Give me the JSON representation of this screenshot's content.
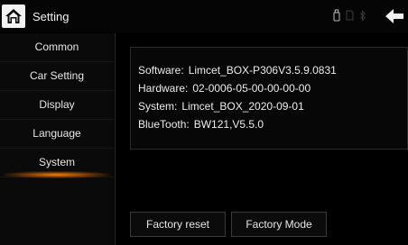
{
  "header": {
    "title": "Setting",
    "icons": [
      "home-icon",
      "usb-icon",
      "sd-card-icon",
      "bluetooth-icon",
      "back-arrow-icon"
    ]
  },
  "sidebar": {
    "items": [
      {
        "label": "Common"
      },
      {
        "label": "Car Setting"
      },
      {
        "label": "Display"
      },
      {
        "label": "Language"
      },
      {
        "label": "System"
      }
    ],
    "active": "System"
  },
  "info": {
    "software_label": "Software:",
    "software_value": "Limcet_BOX-P306V3.5.9.0831",
    "hardware_label": "Hardware:",
    "hardware_value": "02-0006-05-00-00-00-00",
    "system_label": "System:",
    "system_value": "Limcet_BOX_2020-09-01",
    "bluetooth_label": "BlueTooth:",
    "bluetooth_value": "BW121,V5.5.0"
  },
  "buttons": {
    "factory_reset": "Factory reset",
    "factory_mode": "Factory Mode"
  },
  "colors": {
    "accent": "#ff8c00",
    "background": "#000000",
    "text": "#e8e8e8"
  }
}
